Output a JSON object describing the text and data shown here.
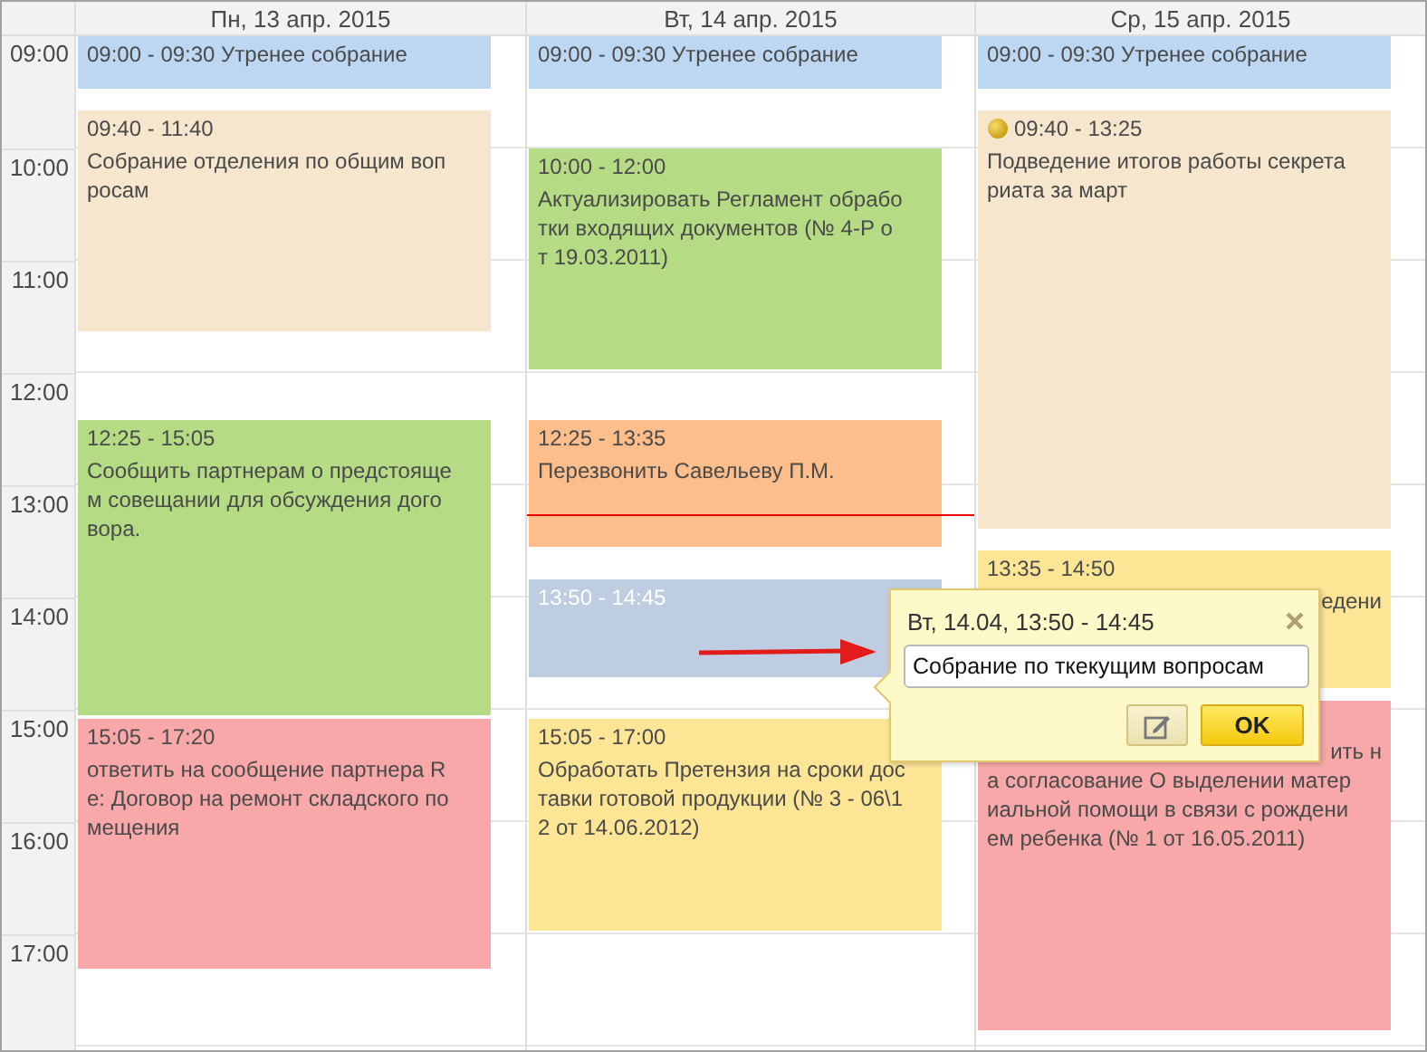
{
  "time_labels": [
    "09:00",
    "10:00",
    "11:00",
    "12:00",
    "13:00",
    "14:00",
    "15:00",
    "16:00",
    "17:00"
  ],
  "days": [
    {
      "title": "Пн, 13 апр. 2015",
      "now_line": false,
      "events": [
        {
          "kind": "inline",
          "text": "09:00 - 09:30 Утренее собрание",
          "color": "#bdd7f3",
          "marker": false,
          "selected": false
        },
        {
          "kind": "block",
          "time": "09:40 - 11:40",
          "lines": [
            "Собрание отделения по общим воп",
            "росам"
          ],
          "color": "#f5e6cd",
          "marker": false,
          "selected": false
        },
        {
          "kind": "block",
          "time": "12:25 - 15:05",
          "lines": [
            "Сообщить партнерам о предстояще",
            "м совещании для обсуждения дого",
            "вора."
          ],
          "color": "#b5dc85",
          "marker": false,
          "selected": false
        },
        {
          "kind": "block",
          "time": "15:05 - 17:20",
          "lines": [
            "ответить на сообщение партнера R",
            "е: Договор на ремонт складского по",
            "мещения"
          ],
          "color": "#f8a8a8",
          "marker": false,
          "selected": false
        }
      ]
    },
    {
      "title": "Вт, 14 апр. 2015",
      "now_line": true,
      "events": [
        {
          "kind": "inline",
          "text": "09:00 - 09:30 Утренее собрание",
          "color": "#bdd7f3",
          "marker": false,
          "selected": false
        },
        {
          "kind": "block",
          "time": "10:00 - 12:00",
          "lines": [
            "Актуализировать Регламент обрабо",
            "тки входящих документов (№ 4-Р о",
            "т 19.03.2011)"
          ],
          "color": "#b5dc85",
          "marker": false,
          "selected": false
        },
        {
          "kind": "block",
          "time": "12:25 - 13:35",
          "lines": [
            "Перезвонить Савельеву П.М."
          ],
          "color": "#fdbe8c",
          "marker": false,
          "selected": false
        },
        {
          "kind": "block",
          "time": "13:50 - 14:45",
          "color": "#bfcde3",
          "marker": false,
          "selected": true
        },
        {
          "kind": "block",
          "time": "15:05 - 17:00",
          "lines": [
            "Обработать Претензия на сроки дос",
            "тавки готовой продукции (№ 3 - 06\\1",
            "2 от 14.06.2012)"
          ],
          "color": "#fde596",
          "marker": false,
          "selected": false
        }
      ]
    },
    {
      "title": "Ср, 15 апр. 2015",
      "now_line": false,
      "events": [
        {
          "kind": "inline",
          "text": "09:00 - 09:30 Утренее собрание",
          "color": "#bdd7f3",
          "marker": false,
          "selected": false
        },
        {
          "kind": "block",
          "time": "09:40 - 13:25",
          "lines": [
            "Подведение итогов работы секрета",
            "риата за март"
          ],
          "color": "#f5e6cd",
          "marker": true,
          "selected": false
        },
        {
          "kind": "clipped",
          "time": "13:35 - 14:50",
          "lines": [
            "едени"
          ],
          "color": "#fde596",
          "marker": false,
          "selected": false
        },
        {
          "kind": "clipped",
          "lines": [
            "ить н",
            "а согласование О выделении матер",
            "иальной помощи в связи с рождени",
            "ем ребенка (№ 1 от 16.05.2011)"
          ],
          "color": "#f8a8a8",
          "marker": false,
          "selected": false
        }
      ]
    }
  ],
  "popup": {
    "title": "Вт, 14.04, 13:50 - 14:45",
    "value": "Собрание по ткекущим вопросам",
    "buttons": [
      {
        "kind": "edit"
      },
      {
        "kind": "ok",
        "label": "OK"
      }
    ]
  }
}
